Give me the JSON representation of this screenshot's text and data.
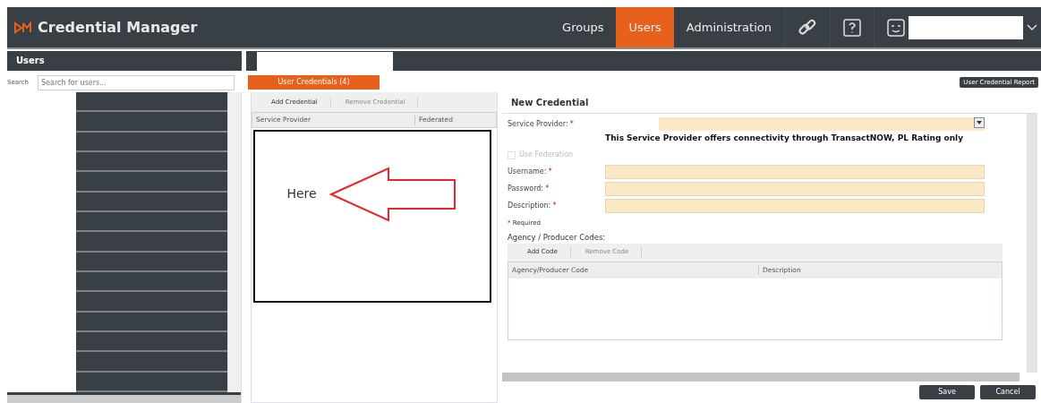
{
  "app": {
    "title": "Credential Manager"
  },
  "nav": [
    {
      "label": "Groups",
      "selected": false
    },
    {
      "label": "Users",
      "selected": true
    },
    {
      "label": "Administration",
      "selected": false
    }
  ],
  "users_panel": {
    "title": "Users",
    "search_label": "Search",
    "search_placeholder": "Search for users..."
  },
  "tabs": [
    {
      "label": "User Credentials (4)",
      "selected": true
    }
  ],
  "report_button": "User Credential Report",
  "credentials_toolbar": [
    {
      "label": "Add Credential",
      "disabled": false
    },
    {
      "label": "Remove Credential",
      "disabled": true
    }
  ],
  "credentials_table": {
    "columns": [
      "Service Provider",
      "Federated"
    ]
  },
  "annotation": {
    "text": "Here"
  },
  "form": {
    "title": "New Credential",
    "required_mark": "*",
    "service_provider": {
      "label": "Service Provider:",
      "required": true
    },
    "notice": "This Service Provider offers connectivity through TransactNOW, PL Rating only",
    "use_federation": {
      "label": "Use Federation",
      "checked": false,
      "disabled": true
    },
    "fields": [
      {
        "label": "Username:",
        "required": true
      },
      {
        "label": "Password:",
        "required": true
      },
      {
        "label": "Description:",
        "required": true
      }
    ],
    "required_note": "Required",
    "codes_title": "Agency / Producer Codes:",
    "codes_toolbar": [
      {
        "label": "Add Code",
        "disabled": false
      },
      {
        "label": "Remove Code",
        "disabled": true
      }
    ],
    "codes_table": {
      "columns": [
        "Agency/Producer Code",
        "Description"
      ]
    }
  },
  "buttons": [
    "Save",
    "Cancel"
  ]
}
